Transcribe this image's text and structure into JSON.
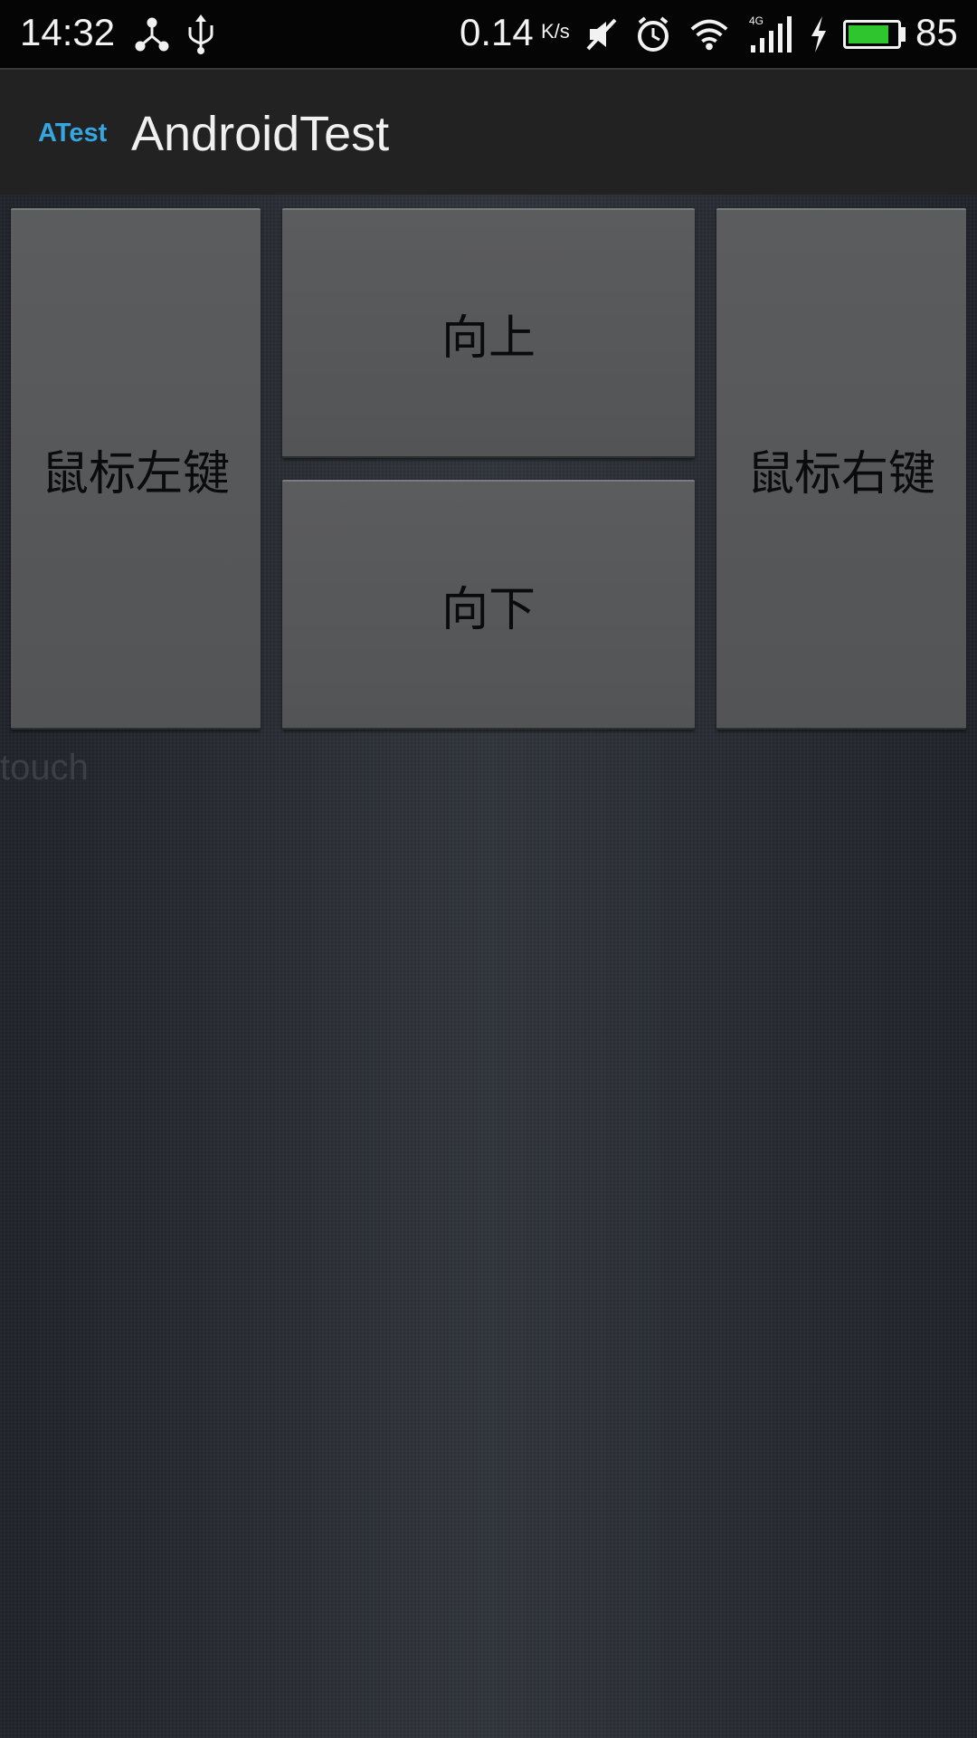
{
  "status_bar": {
    "time": "14:32",
    "net_speed": "0.14",
    "net_speed_unit": "K/s",
    "network_type": "4G",
    "battery_percent": "85",
    "battery_level": 0.85,
    "icons": [
      "share-icon",
      "usb-icon",
      "mute-icon",
      "alarm-icon",
      "wifi-icon",
      "signal-icon",
      "charging-icon",
      "battery-icon"
    ]
  },
  "action_bar": {
    "logo": "ATest",
    "title": "AndroidTest",
    "logo_color": "#36a6e0"
  },
  "controls": {
    "left_mouse_button": "鼠标左键",
    "up_button": "向上",
    "down_button": "向下",
    "right_mouse_button": "鼠标右键"
  },
  "touch_area": {
    "label": "touch"
  },
  "colors": {
    "battery": "#2fc52f",
    "button_face": "#58595b"
  }
}
